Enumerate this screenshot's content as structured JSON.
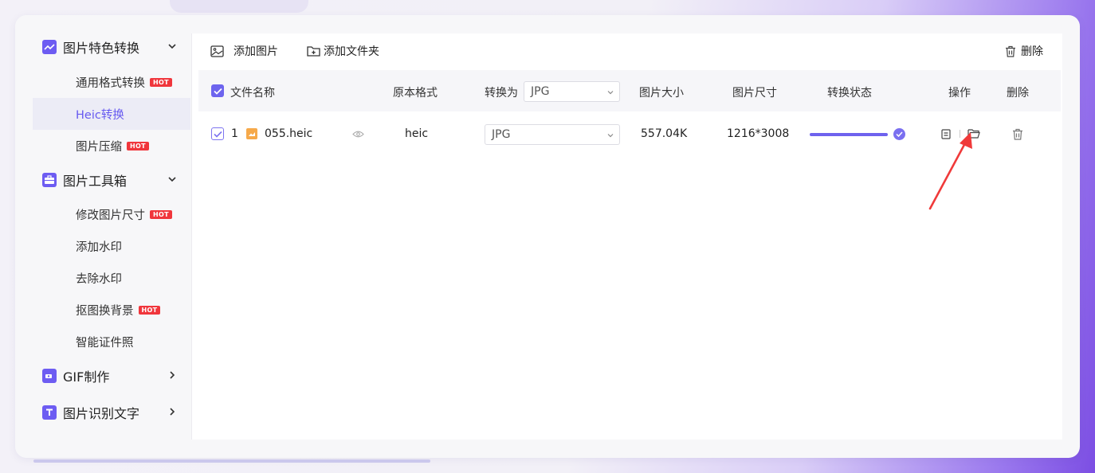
{
  "sidebar": {
    "sections": [
      {
        "title": "图片特色转换",
        "icon": "image-convert-icon",
        "expanded": true
      },
      {
        "title": "图片工具箱",
        "icon": "toolbox-icon",
        "expanded": true
      },
      {
        "title": "GIF制作",
        "icon": "gif-icon",
        "expanded": false
      },
      {
        "title": "图片识别文字",
        "icon": "text-recognition-icon",
        "expanded": false
      }
    ],
    "items": [
      {
        "label": "通用格式转换",
        "hot": "HOT"
      },
      {
        "label": "Heic转换",
        "active": true
      },
      {
        "label": "图片压缩",
        "hot": "HOT"
      },
      {
        "label": "修改图片尺寸",
        "hot": "HOT"
      },
      {
        "label": "添加水印"
      },
      {
        "label": "去除水印"
      },
      {
        "label": "抠图换背景",
        "hot": "HOT"
      },
      {
        "label": "智能证件照"
      }
    ]
  },
  "toolbar": {
    "add_image": "添加图片",
    "add_folder": "添加文件夹",
    "delete": "删除"
  },
  "table": {
    "headers": {
      "filename": "文件名称",
      "original_format": "原本格式",
      "convert_to": "转换为",
      "convert_to_value": "JPG",
      "size": "图片大小",
      "dimensions": "图片尺寸",
      "status": "转换状态",
      "actions": "操作",
      "delete": "删除"
    },
    "rows": [
      {
        "index": "1",
        "filename": "055.heic",
        "original_format": "heic",
        "convert_to": "JPG",
        "size": "557.04K",
        "dimensions": "1216*3008",
        "progress": 1.0,
        "status": "complete"
      }
    ]
  },
  "colors": {
    "accent": "#6d64ee",
    "hot_badge": "#f0363c",
    "annotation_arrow": "#f03a3a"
  }
}
